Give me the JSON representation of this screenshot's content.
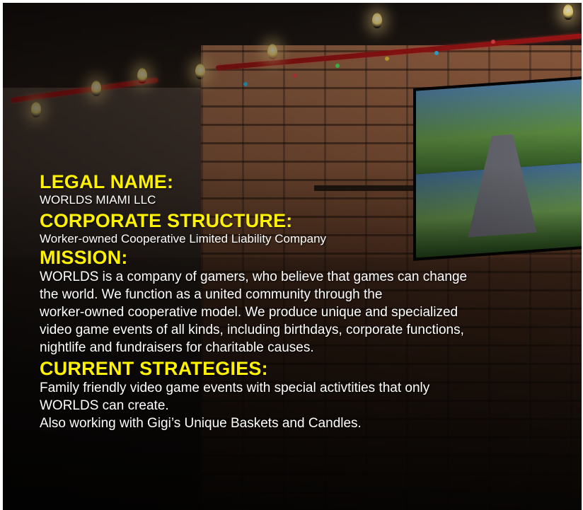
{
  "sections": [
    {
      "heading": "LEGAL NAME:",
      "lines": [
        "WORLDS MIAMI LLC"
      ]
    },
    {
      "heading": "CORPORATE STRUCTURE:",
      "lines": [
        "Worker-owned Cooperative Limited Liability Company"
      ]
    },
    {
      "heading": "MISSION:",
      "lines": [
        "WORLDS is a company of gamers, who believe that games can change",
        "the world. We function as a united community through the",
        "worker-owned cooperative model. We produce unique and specialized",
        "video game events of all kinds, including birthdays, corporate functions,",
        "nightlife and fundraisers for charitable causes."
      ]
    },
    {
      "heading": "CURRENT STRATEGIES:",
      "lines": [
        "Family friendly video game events with special activtities that only",
        "WORLDS can create.",
        "Also working with Gigi’s Unique Baskets and Candles."
      ]
    }
  ],
  "colors": {
    "heading": "#fff200",
    "body": "#ffffff"
  }
}
